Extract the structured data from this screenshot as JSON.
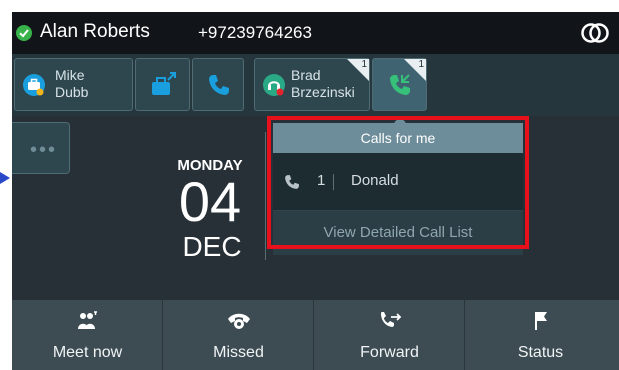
{
  "header": {
    "user_name": "Alan Roberts",
    "phone_number": "+97239764263",
    "presence_color": "#38b24a"
  },
  "favorites": {
    "contact1": {
      "first": "Mike",
      "last": "Dubb"
    },
    "contact2": {
      "first": "Brad",
      "last": "Brzezinski",
      "badge": "1"
    },
    "call_badge": "1"
  },
  "date": {
    "weekday": "MONDAY",
    "day": "04",
    "month": "DEC"
  },
  "calls_popup": {
    "title": "Calls for me",
    "calls": [
      {
        "count": "1",
        "name": "Donald"
      }
    ],
    "view_link": "View Detailed Call List"
  },
  "softkeys": [
    {
      "label": "Meet now",
      "icon": "meet-icon"
    },
    {
      "label": "Missed",
      "icon": "missed-call-icon"
    },
    {
      "label": "Forward",
      "icon": "forward-call-icon"
    },
    {
      "label": "Status",
      "icon": "flag-icon"
    }
  ]
}
